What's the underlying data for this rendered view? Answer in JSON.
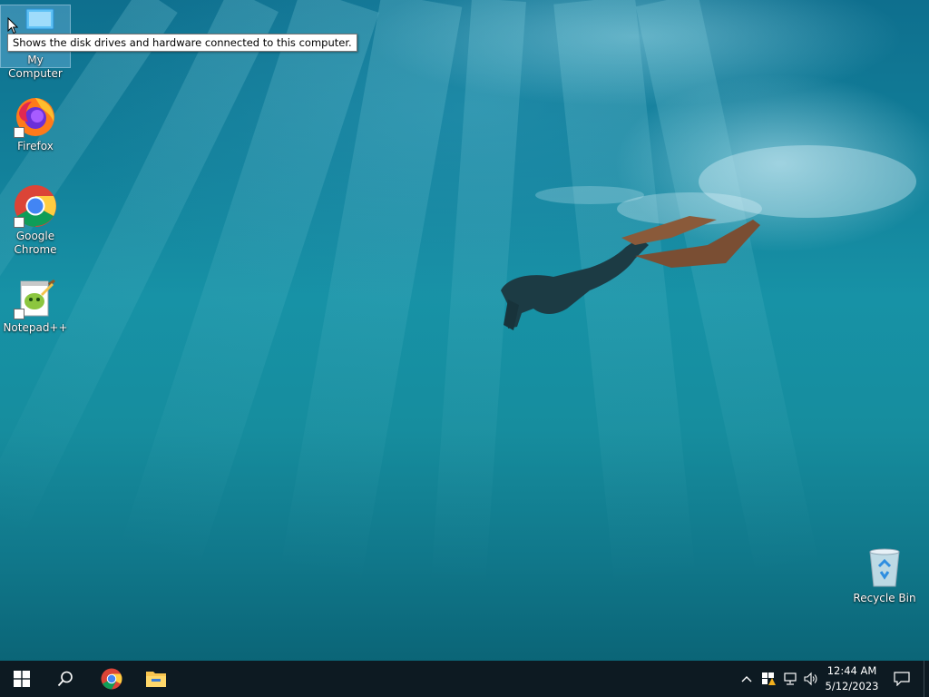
{
  "desktop": {
    "icons": [
      {
        "label": "My Computer",
        "icon": "this-pc-icon",
        "selected": true
      },
      {
        "label": "Firefox",
        "icon": "firefox-icon",
        "shortcut": true
      },
      {
        "label": "Google Chrome",
        "icon": "chrome-icon",
        "shortcut": true
      },
      {
        "label": "Notepad++",
        "icon": "notepad-plus-plus-icon",
        "shortcut": true
      },
      {
        "label": "Recycle Bin",
        "icon": "recycle-bin-icon"
      }
    ],
    "tooltip": "Shows the disk drives and hardware connected to this computer.",
    "wallpaper": "underwater-freediver"
  },
  "taskbar": {
    "start": {
      "icon": "windows-logo-icon"
    },
    "search": {
      "icon": "search-icon"
    },
    "pinned": [
      {
        "name": "Google Chrome",
        "icon": "chrome-icon"
      },
      {
        "name": "File Explorer",
        "icon": "folder-icon"
      }
    ],
    "tray": {
      "icons": [
        "chevron-up-icon",
        "windows-security-warning-icon",
        "network-icon",
        "volume-icon"
      ],
      "time": "12:44 AM",
      "date": "5/12/2023",
      "notification_icon": "action-center-icon"
    },
    "colors": {
      "background": "#0d1a22",
      "text": "#ffffff"
    }
  }
}
